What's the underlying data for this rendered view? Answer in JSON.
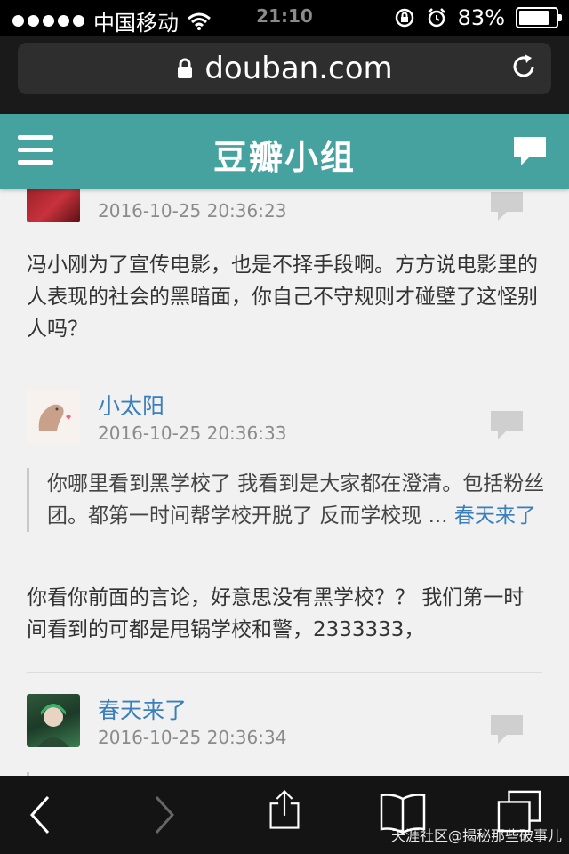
{
  "status_bar": {
    "carrier": "中国移动",
    "time": "21:10",
    "battery": "83%",
    "battery_level": 0.83
  },
  "browser": {
    "url": "douban.com"
  },
  "header": {
    "title": "豆瓣小组"
  },
  "comments": [
    {
      "time": "2016-10-25 20:36:23",
      "text": "冯小刚为了宣传电影，也是不择手段啊。方方说电影里的人表现的社会的黑暗面，你自己不守规则才碰壁了这怪别人吗？"
    },
    {
      "username": "小太阳",
      "time": "2016-10-25 20:36:33",
      "quote_text": "你哪里看到黑学校了 我看到是大家都在澄清。包括粉丝团。都第一时间帮学校开脱了 反而学校现 ...",
      "quote_author": "春天来了",
      "text": "你看你前面的言论，好意思没有黑学校？？ 我们第一时间看到的可都是甩锅学校和警，2333333，"
    },
    {
      "username": "春天来了",
      "time": "2016-10-25 20:36:34"
    }
  ],
  "watermark": "天涯社区@揭秘那些破事儿"
}
